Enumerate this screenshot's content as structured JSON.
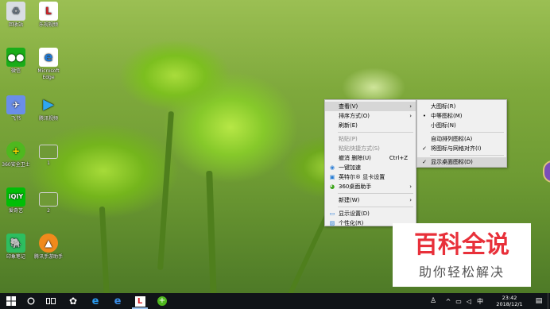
{
  "desktop_icons": [
    {
      "label": "回收站",
      "icon": "recycle-bin-icon",
      "color": "#d9dde3"
    },
    {
      "label": "乐视视频",
      "icon": "letv-icon",
      "color": "#d62027"
    },
    {
      "label": "微信",
      "icon": "wechat-icon",
      "color": "#1aad19"
    },
    {
      "label": "Microsoft Edge",
      "icon": "edge-icon",
      "color": "#1e78d4"
    },
    {
      "label": "飞书",
      "icon": "feishu-icon",
      "color": "#6a8ee8"
    },
    {
      "label": "腾讯视频",
      "icon": "tencent-video-icon",
      "color": "#2fa7f0"
    },
    {
      "label": "360安全卫士",
      "icon": "360-guard-icon",
      "color": "#4fb81f"
    },
    {
      "label": "1",
      "icon": "image-thumb-icon",
      "color": "#6f9a36"
    },
    {
      "label": "爱奇艺",
      "icon": "iqiyi-icon",
      "color": "#00be06"
    },
    {
      "label": "2",
      "icon": "image-thumb-icon",
      "color": "#6f9a36"
    },
    {
      "label": "印象笔记",
      "icon": "evernote-icon",
      "color": "#2dbe60"
    },
    {
      "label": "腾讯手游助手",
      "icon": "tencent-gamebox-icon",
      "color": "#f08a1c"
    }
  ],
  "context_menu": {
    "view": "查看(V)",
    "sort": "排序方式(O)",
    "refresh": "刷新(E)",
    "paste": "粘贴(P)",
    "paste_shortcut": "粘贴快捷方式(S)",
    "undo": "撤消 删除(U)",
    "undo_shortcut": "Ctrl+Z",
    "accelerate": "一键加速",
    "graphics": "英特尔® 显卡设置",
    "desktop360": "360桌面助手",
    "new": "新建(W)",
    "display": "显示设置(D)",
    "personalize": "个性化(R)"
  },
  "view_submenu": {
    "large": "大图标(R)",
    "medium": "中等图标(M)",
    "small": "小图标(N)",
    "auto_arrange": "自动排列图标(A)",
    "align_grid": "将图标与网格对齐(I)",
    "show_desktop_icons": "显示桌面图标(D)"
  },
  "watermark": {
    "title": "百科全说",
    "subtitle": "助你轻松解决"
  },
  "taskbar": {
    "time": "23:42",
    "date": "2018/12/1",
    "ime": "中"
  },
  "colors": {
    "accent": "#1e78d4",
    "watermark_red": "#e8303a",
    "taskbar": "#101418"
  }
}
